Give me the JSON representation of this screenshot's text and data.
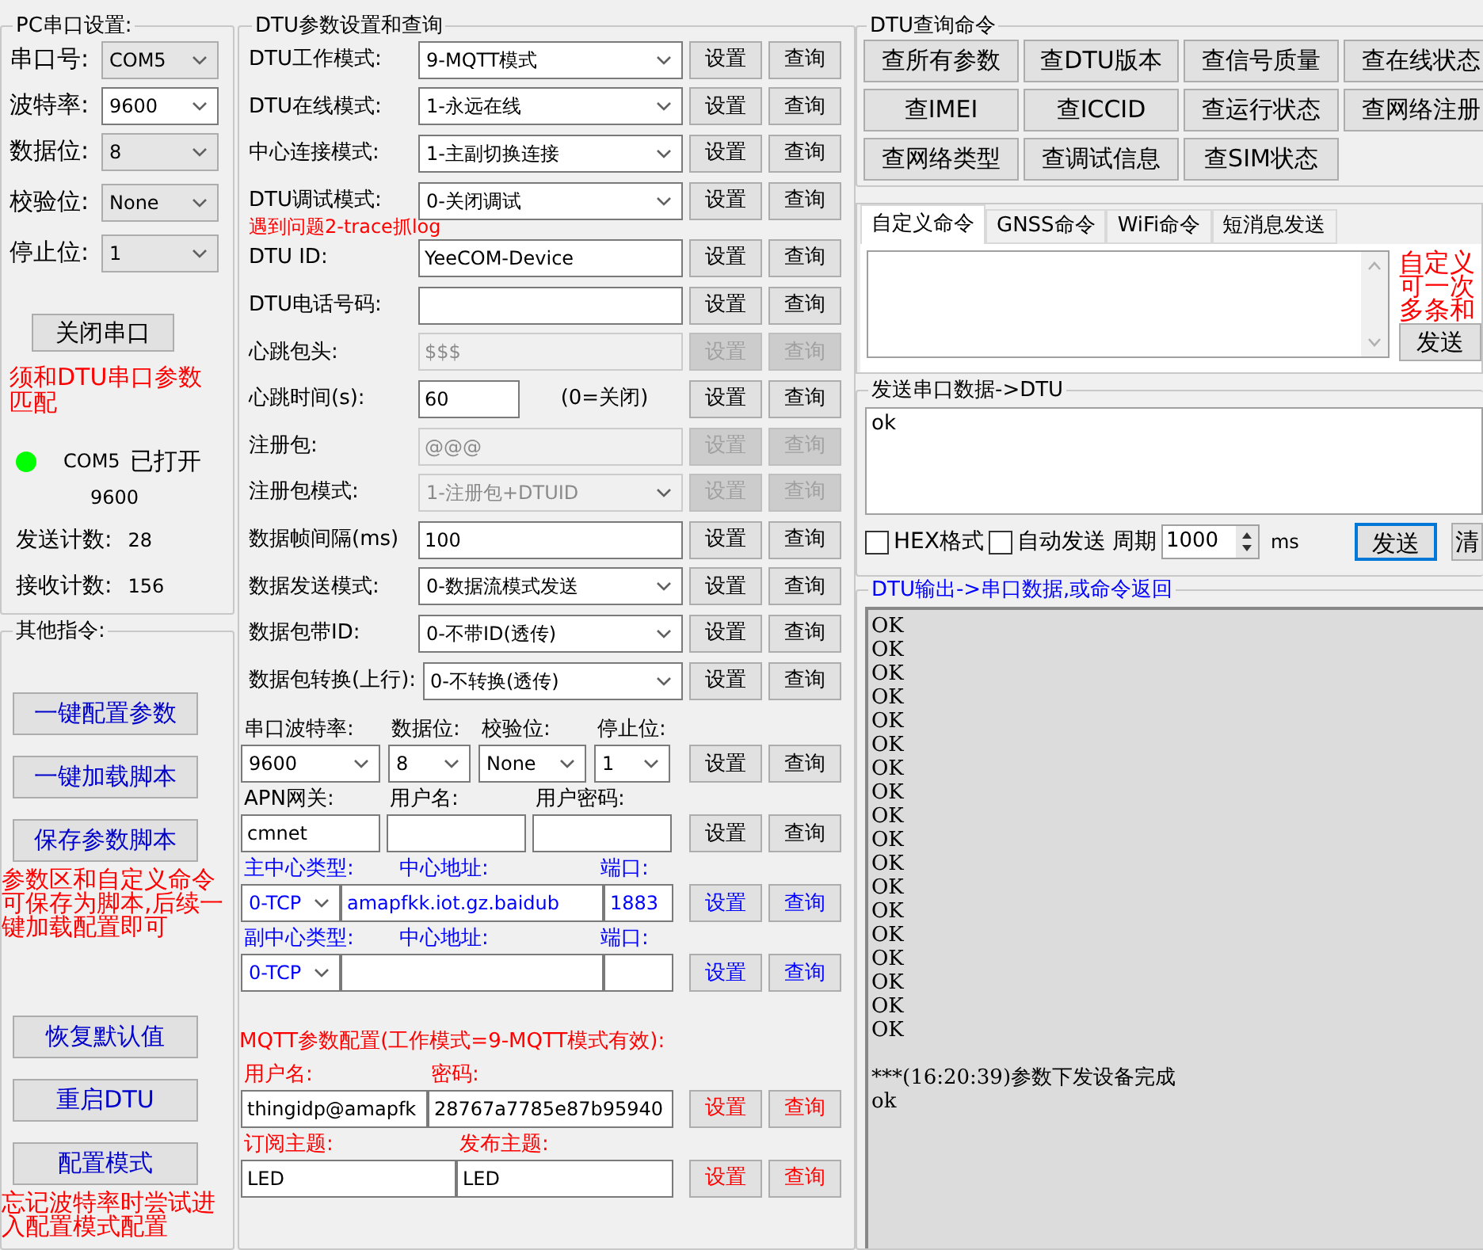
{
  "pc_serial": {
    "title": "PC串口设置:",
    "fields": [
      {
        "label": "串口号:",
        "value": "COM5",
        "kind": "list"
      },
      {
        "label": "波特率:",
        "value": "9600",
        "kind": "combo"
      },
      {
        "label": "数据位:",
        "value": "8",
        "kind": "list"
      },
      {
        "label": "校验位:",
        "value": "None",
        "kind": "list"
      },
      {
        "label": "停止位:",
        "value": "1",
        "kind": "list"
      }
    ],
    "close_button": "关闭串口",
    "note": "须和DTU串口参数匹配",
    "status": {
      "color": "#00ff00",
      "port": "COM5",
      "state": "已打开",
      "baud": "9600"
    },
    "counters": [
      {
        "label": "发送计数:",
        "value": "28"
      },
      {
        "label": "接收计数:",
        "value": "156"
      }
    ]
  },
  "other_commands": {
    "title": "其他指令:",
    "items": [
      {
        "kind": "button",
        "text": "一键配置参数"
      },
      {
        "kind": "button",
        "text": "一键加载脚本"
      },
      {
        "kind": "button",
        "text": "保存参数脚本"
      },
      {
        "kind": "note",
        "text": "参数区和自定义命令可保存为脚本,后续一键加载配置即可"
      },
      {
        "kind": "button",
        "text": "恢复默认值"
      },
      {
        "kind": "button",
        "text": "重启DTU"
      },
      {
        "kind": "button",
        "text": "配置模式"
      },
      {
        "kind": "note",
        "text": "忘记波特率时尝试进入配置模式配置"
      }
    ]
  },
  "dtu_params": {
    "title": "DTU参数设置和查询",
    "rows": [
      {
        "label": "DTU工作模式:",
        "kind": "select",
        "value": "9-MQTT模式",
        "disabled": false,
        "buttons": [
          "设置",
          "查询"
        ]
      },
      {
        "label": "DTU在线模式:",
        "kind": "select",
        "value": "1-永远在线",
        "disabled": false,
        "buttons": [
          "设置",
          "查询"
        ]
      },
      {
        "label": "中心连接模式:",
        "kind": "select",
        "value": "1-主副切换连接",
        "disabled": false,
        "buttons": [
          "设置",
          "查询"
        ]
      },
      {
        "label": "DTU调试模式:",
        "kind": "select",
        "value": "0-关闭调试",
        "disabled": false,
        "note": "遇到问题2-trace抓log",
        "buttons": [
          "设置",
          "查询"
        ]
      },
      {
        "label": "DTU ID:",
        "kind": "input",
        "value": "YeeCOM-Device",
        "disabled": false,
        "buttons": [
          "设置",
          "查询"
        ]
      },
      {
        "label": "DTU电话号码:",
        "kind": "input",
        "disabled": false,
        "buttons": [
          "设置",
          "查询"
        ]
      },
      {
        "label": "心跳包头:",
        "kind": "input",
        "value": "$$$",
        "disabled": true,
        "buttons": [
          "设置",
          "查询"
        ]
      },
      {
        "label": "心跳时间(s):",
        "kind": "input",
        "value": "60",
        "hint": "(0=关闭)",
        "disabled": false,
        "buttons": [
          "设置",
          "查询"
        ]
      },
      {
        "label": "注册包:",
        "kind": "input",
        "value": "@@@",
        "disabled": true,
        "buttons": [
          "设置",
          "查询"
        ]
      },
      {
        "label": "注册包模式:",
        "kind": "select",
        "value": "1-注册包+DTUID",
        "disabled": true,
        "buttons": [
          "设置",
          "查询"
        ]
      },
      {
        "label": "数据帧间隔(ms)",
        "kind": "input",
        "value": "100",
        "disabled": false,
        "buttons": [
          "设置",
          "查询"
        ]
      },
      {
        "label": "数据发送模式:",
        "kind": "select",
        "value": "0-数据流模式发送",
        "disabled": false,
        "buttons": [
          "设置",
          "查询"
        ]
      },
      {
        "label": "数据包带ID:",
        "kind": "select",
        "value": "0-不带ID(透传)",
        "disabled": false,
        "buttons": [
          "设置",
          "查询"
        ]
      },
      {
        "label": "数据包转换(上行):",
        "kind": "select",
        "value": "0-不转换(透传)",
        "disabled": false,
        "buttons": [
          "设置",
          "查询"
        ]
      }
    ],
    "groups": [
      {
        "kind": "serial",
        "color": "#000000",
        "fields": [
          {
            "label": "串口波特率:",
            "kind": "select",
            "value": "9600"
          },
          {
            "label": "数据位:",
            "kind": "select",
            "value": "8"
          },
          {
            "label": "校验位:",
            "kind": "select",
            "value": "None"
          },
          {
            "label": "停止位:",
            "kind": "select",
            "value": "1"
          }
        ],
        "buttons": [
          "设置",
          "查询"
        ]
      },
      {
        "kind": "apn",
        "color": "#000000",
        "fields": [
          {
            "label": "APN网关:",
            "kind": "input",
            "value": "cmnet"
          },
          {
            "label": "用户名:",
            "kind": "input"
          },
          {
            "label": "用户密码:",
            "kind": "input"
          }
        ],
        "buttons": [
          "设置",
          "查询"
        ]
      },
      {
        "kind": "center",
        "color": "#0000ff",
        "fields": [
          {
            "label": "主中心类型:",
            "kind": "select",
            "value": "0-TCP"
          },
          {
            "label": "中心地址:",
            "kind": "input",
            "value": "amapfkk.iot.gz.baidub"
          },
          {
            "label": "端口:",
            "kind": "input",
            "value": "1883"
          }
        ],
        "buttons": [
          "设置",
          "查询"
        ]
      },
      {
        "kind": "center",
        "color": "#0000ff",
        "fields": [
          {
            "label": "副中心类型:",
            "kind": "select",
            "value": "0-TCP"
          },
          {
            "label": "中心地址:",
            "kind": "input"
          },
          {
            "label": "端口:",
            "kind": "input"
          }
        ],
        "buttons": [
          "设置",
          "查询"
        ]
      },
      {
        "kind": "heading",
        "color": "#ff0000",
        "text": "MQTT参数配置(工作模式=9-MQTT模式有效):"
      },
      {
        "kind": "credentials",
        "color": "#ff0000",
        "fields": [
          {
            "label": "用户名:",
            "kind": "input",
            "value": "thingidp@amapfk"
          },
          {
            "label": "密码:",
            "kind": "input",
            "value": "28767a7785e87b95940"
          }
        ],
        "buttons": [
          "设置",
          "查询"
        ]
      },
      {
        "kind": "topics",
        "color": "#ff0000",
        "fields": [
          {
            "label": "订阅主题:",
            "kind": "input",
            "value": "LED"
          },
          {
            "label": "发布主题:",
            "kind": "input",
            "value": "LED"
          }
        ],
        "buttons": [
          "设置",
          "查询"
        ]
      }
    ]
  },
  "query_commands": {
    "title": "DTU查询命令",
    "buttons": [
      "查所有参数",
      "查DTU版本",
      "查信号质量",
      "查在线状态",
      "查IMEI",
      "查ICCID",
      "查运行状态",
      "查网络注册",
      "查网络类型",
      "查调试信息",
      "查SIM状态"
    ]
  },
  "custom": {
    "tabs": [
      {
        "label": "自定义命令",
        "selected": true
      },
      {
        "label": "GNSS命令",
        "selected": false
      },
      {
        "label": "WiFi命令",
        "selected": false
      },
      {
        "label": "短消息发送",
        "selected": false
      }
    ],
    "note": "自定义可一次多条和",
    "send_button": "发送"
  },
  "send_serial": {
    "title": "发送串口数据->DTU",
    "text": "ok",
    "options": [
      {
        "label": "HEX格式",
        "checked": false
      },
      {
        "label": "自动发送",
        "checked": false
      }
    ],
    "period_label": "周期",
    "period": "1000",
    "unit": "ms",
    "send_button": "发送",
    "clear_button": "清"
  },
  "output": {
    "title": "DTU输出->串口数据,或命令返回",
    "lines": [
      "OK",
      "OK",
      "OK",
      "OK",
      "OK",
      "OK",
      "OK",
      "OK",
      "OK",
      "OK",
      "OK",
      "OK",
      "OK",
      "OK",
      "OK",
      "OK",
      "OK",
      "OK"
    ],
    "messages": [
      "***(16:20:39)参数下发设备完成",
      "ok"
    ]
  }
}
